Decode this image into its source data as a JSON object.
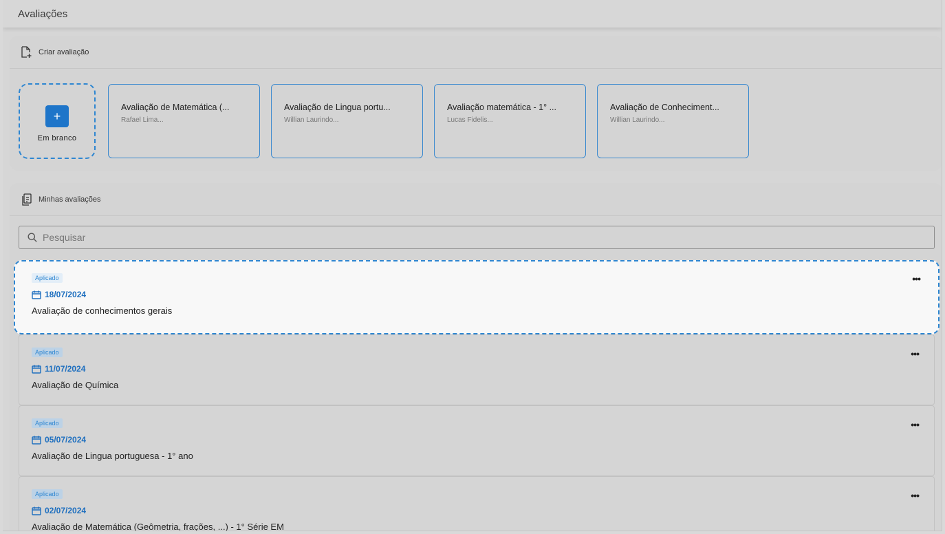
{
  "page": {
    "title": "Avaliações"
  },
  "create": {
    "header": "Criar avaliação",
    "blank_label": "Em branco",
    "blank_symbol": "+",
    "templates": [
      {
        "title": "Avaliação de Matemática (...",
        "author": "Rafael Lima..."
      },
      {
        "title": "Avaliação de Lingua portu...",
        "author": "Willian Laurindo..."
      },
      {
        "title": "Avaliação matemática - 1° ...",
        "author": "Lucas Fidelis..."
      },
      {
        "title": "Avaliação de Conheciment...",
        "author": "Willian Laurindo..."
      }
    ]
  },
  "mine": {
    "header": "Minhas avaliações",
    "search_placeholder": "Pesquisar",
    "items": [
      {
        "status": "Aplicado",
        "date": "18/07/2024",
        "title": "Avaliação de conhecimentos gerais",
        "menu": "•••"
      },
      {
        "status": "Aplicado",
        "date": "11/07/2024",
        "title": "Avaliação de Química",
        "menu": "•••"
      },
      {
        "status": "Aplicado",
        "date": "05/07/2024",
        "title": "Avaliação de Lingua portuguesa - 1° ano",
        "menu": "•••"
      },
      {
        "status": "Aplicado",
        "date": "02/07/2024",
        "title": "Avaliação de Matemática (Geômetria, frações, ...) - 1° Série EM",
        "menu": "•••"
      }
    ]
  },
  "colors": {
    "accent": "#1e75c9",
    "highlight_border": "#2e86d1",
    "background": "#d6d6d6"
  }
}
